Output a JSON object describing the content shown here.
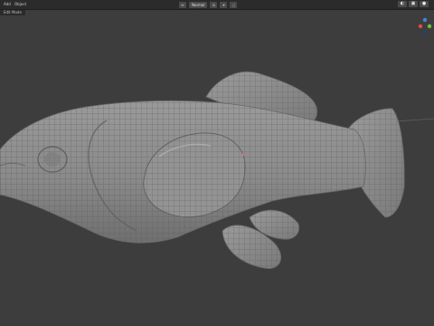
{
  "header": {
    "menu_view": "Add",
    "menu_select": "Object",
    "transform_orientation": "Normal"
  },
  "viewport": {
    "mode_label": "Edit Mode",
    "background_color": "#3d3d3d",
    "mesh_color": "#8c8c8c",
    "wire_color": "#555555"
  },
  "gizmo": {
    "x_color": "#e04a4a",
    "y_color": "#6fbf3a",
    "z_color": "#3f86e0"
  }
}
